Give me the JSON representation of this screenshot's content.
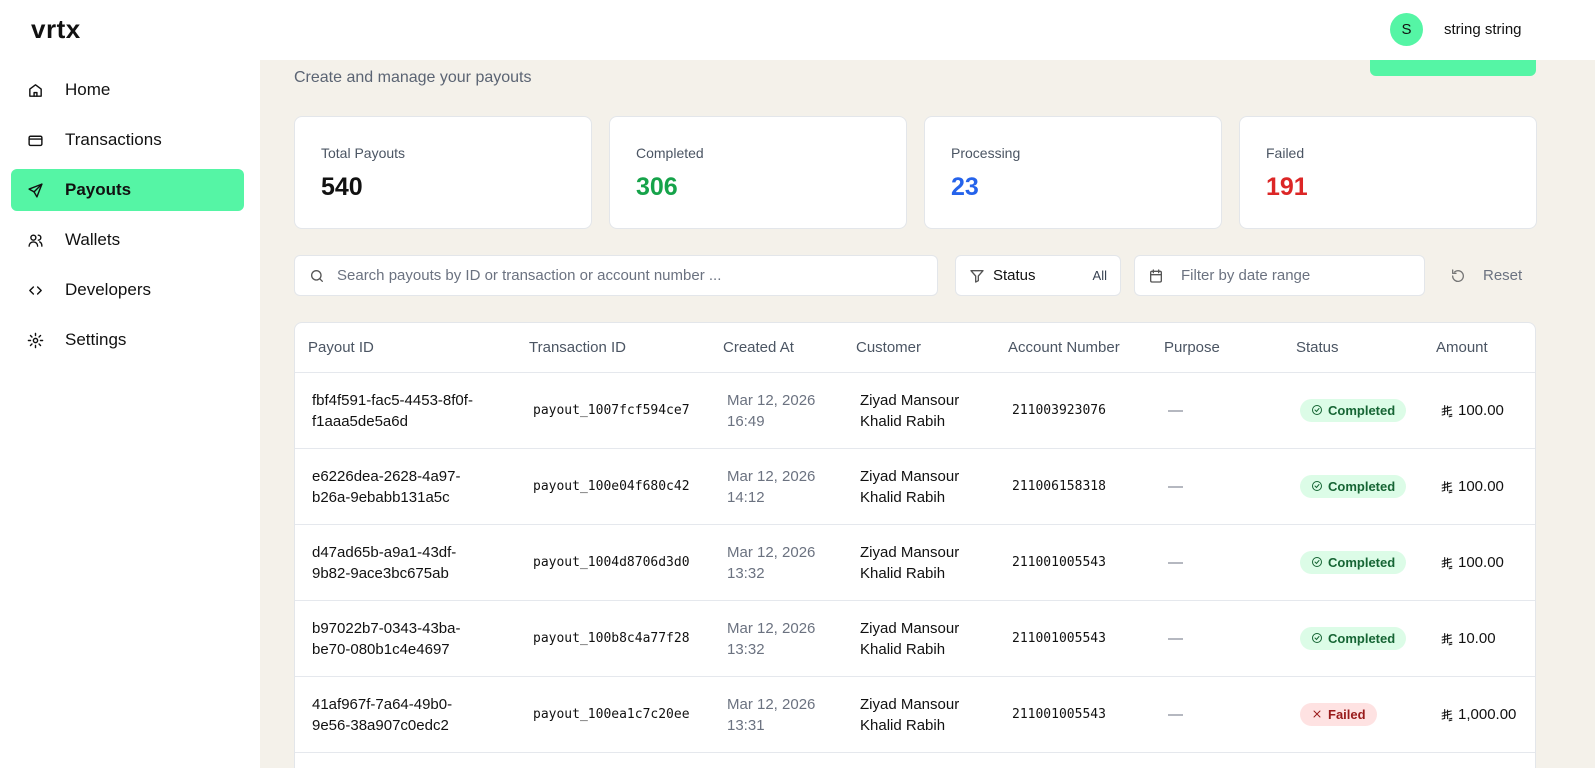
{
  "app": {
    "logo": "vrtx",
    "user": {
      "initial": "S",
      "name": "string string"
    }
  },
  "sidebar": {
    "items": [
      {
        "label": "Home",
        "icon": "home-icon"
      },
      {
        "label": "Transactions",
        "icon": "credit-card-icon"
      },
      {
        "label": "Payouts",
        "icon": "send-icon",
        "active": true
      },
      {
        "label": "Wallets",
        "icon": "users-icon"
      },
      {
        "label": "Developers",
        "icon": "code-icon"
      },
      {
        "label": "Settings",
        "icon": "gear-icon"
      }
    ]
  },
  "page": {
    "subtitle": "Create and manage your payouts"
  },
  "stats": [
    {
      "label": "Total Payouts",
      "value": "540",
      "color": "#111111"
    },
    {
      "label": "Completed",
      "value": "306",
      "color": "#16a34a"
    },
    {
      "label": "Processing",
      "value": "23",
      "color": "#2563eb"
    },
    {
      "label": "Failed",
      "value": "191",
      "color": "#dc2626"
    }
  ],
  "filters": {
    "search_placeholder": "Search payouts by ID or transaction or account number ...",
    "status_label": "Status",
    "status_value": "All",
    "date_placeholder": "Filter by date range",
    "reset_label": "Reset"
  },
  "table": {
    "columns": [
      "Payout ID",
      "Transaction ID",
      "Created At",
      "Customer",
      "Account Number",
      "Purpose",
      "Status",
      "Amount"
    ],
    "rows": [
      {
        "payout_id": [
          "fbf4f591-fac5-4453-8f0f-",
          "f1aaa5de5a6d"
        ],
        "transaction_id": "payout_1007fcf594ce7",
        "date": "Mar 12, 2026",
        "time": "16:49",
        "customer": [
          "Ziyad Mansour",
          "Khalid Rabih"
        ],
        "account": "211003923076",
        "purpose": "—",
        "status": "Completed",
        "amount": "100.00"
      },
      {
        "payout_id": [
          "e6226dea-2628-4a97-",
          "b26a-9ebabb131a5c"
        ],
        "transaction_id": "payout_100e04f680c42",
        "date": "Mar 12, 2026",
        "time": "14:12",
        "customer": [
          "Ziyad Mansour",
          "Khalid Rabih"
        ],
        "account": "211006158318",
        "purpose": "—",
        "status": "Completed",
        "amount": "100.00"
      },
      {
        "payout_id": [
          "d47ad65b-a9a1-43df-",
          "9b82-9ace3bc675ab"
        ],
        "transaction_id": "payout_1004d8706d3d0",
        "date": "Mar 12, 2026",
        "time": "13:32",
        "customer": [
          "Ziyad Mansour",
          "Khalid Rabih"
        ],
        "account": "211001005543",
        "purpose": "—",
        "status": "Completed",
        "amount": "100.00"
      },
      {
        "payout_id": [
          "b97022b7-0343-43ba-",
          "be70-080b1c4e4697"
        ],
        "transaction_id": "payout_100b8c4a77f28",
        "date": "Mar 12, 2026",
        "time": "13:32",
        "customer": [
          "Ziyad Mansour",
          "Khalid Rabih"
        ],
        "account": "211001005543",
        "purpose": "—",
        "status": "Completed",
        "amount": "10.00"
      },
      {
        "payout_id": [
          "41af967f-7a64-49b0-",
          "9e56-38a907c0edc2"
        ],
        "transaction_id": "payout_100ea1c7c20ee",
        "date": "Mar 12, 2026",
        "time": "13:31",
        "customer": [
          "Ziyad Mansour",
          "Khalid Rabih"
        ],
        "account": "211001005543",
        "purpose": "—",
        "status": "Failed",
        "amount": "1,000.00"
      }
    ]
  },
  "colors": {
    "accent": "#55f5a5",
    "background": "#f4f1ea"
  }
}
